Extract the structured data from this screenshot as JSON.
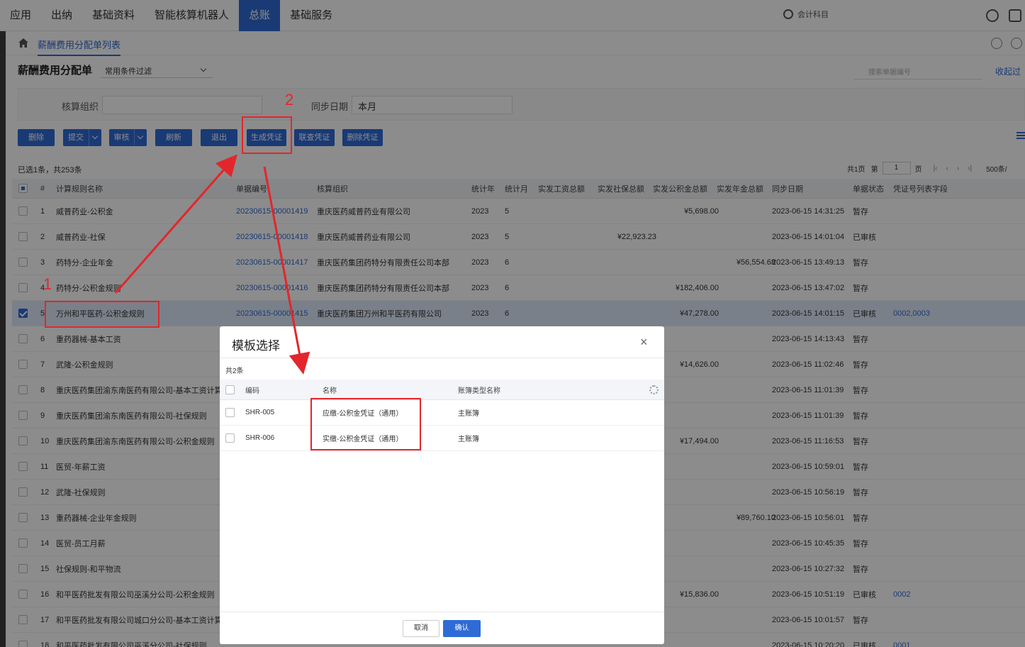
{
  "nav": {
    "items": [
      {
        "label": "应用",
        "active": false
      },
      {
        "label": "出纳",
        "active": false
      },
      {
        "label": "基础资料",
        "active": false
      },
      {
        "label": "智能核算机器人",
        "active": false
      },
      {
        "label": "总账",
        "active": true
      },
      {
        "label": "基础服务",
        "active": false
      }
    ],
    "search_placeholder": "会计科目"
  },
  "breadcrumb": {
    "current": "薪酬费用分配单列表"
  },
  "page": {
    "title": "薪酬费用分配单",
    "filter_select": "常用条件过滤",
    "bill_search_placeholder": "搜索单据编号",
    "collapse": "收起过"
  },
  "query": {
    "org_label": "核算组织",
    "org_value": "",
    "date_label": "同步日期",
    "date_value": "本月"
  },
  "toolbar": {
    "delete": "删除",
    "submit": "提交",
    "audit": "审核",
    "refresh": "刷新",
    "exit": "退出",
    "gen_voucher": "生成凭证",
    "query_voucher": "联查凭证",
    "del_voucher": "删除凭证"
  },
  "list": {
    "summary": "已选1条，共253条",
    "pager": {
      "total_pages": "共1页",
      "page_prefix": "第",
      "page": "1",
      "page_suffix": "页",
      "size": "500条/"
    },
    "columns": [
      "#",
      "计算规则名称",
      "单据编号",
      "核算组织",
      "统计年",
      "统计月",
      "实发工资总额",
      "实发社保总额",
      "实发公积金总额",
      "实发年金总额",
      "同步日期",
      "单据状态",
      "凭证号列表字段"
    ],
    "rows": [
      {
        "no": "1",
        "name": "威普药业-公积金",
        "bill": "20230615-00001419",
        "org": "重庆医药威普药业有限公司",
        "year": "2023",
        "month": "5",
        "salary": "",
        "social": "",
        "fund": "¥5,698.00",
        "annuity": "",
        "date": "2023-06-15 14:31:25",
        "status": "暂存",
        "voucher": "",
        "selected": false
      },
      {
        "no": "2",
        "name": "威普药业-社保",
        "bill": "20230615-00001418",
        "org": "重庆医药威普药业有限公司",
        "year": "2023",
        "month": "5",
        "salary": "",
        "social": "¥22,923.23",
        "fund": "",
        "annuity": "",
        "date": "2023-06-15 14:01:04",
        "status": "已审核",
        "voucher": "",
        "selected": false
      },
      {
        "no": "3",
        "name": "药特分-企业年金",
        "bill": "20230615-00001417",
        "org": "重庆医药集团药特分有限责任公司本部",
        "year": "2023",
        "month": "6",
        "salary": "",
        "social": "",
        "fund": "",
        "annuity": "¥56,554.68",
        "date": "2023-06-15 13:49:13",
        "status": "暂存",
        "voucher": "",
        "selected": false
      },
      {
        "no": "4",
        "name": "药特分-公积金规则",
        "bill": "20230615-00001416",
        "org": "重庆医药集团药特分有限责任公司本部",
        "year": "2023",
        "month": "6",
        "salary": "",
        "social": "",
        "fund": "¥182,406.00",
        "annuity": "",
        "date": "2023-06-15 13:47:02",
        "status": "暂存",
        "voucher": "",
        "selected": false
      },
      {
        "no": "5",
        "name": "万州和平医药-公积金规则",
        "bill": "20230615-00001415",
        "org": "重庆医药集团万州和平医药有限公司",
        "year": "2023",
        "month": "6",
        "salary": "",
        "social": "",
        "fund": "¥47,278.00",
        "annuity": "",
        "date": "2023-06-15 14:01:15",
        "status": "已审核",
        "voucher": "0002,0003",
        "selected": true
      },
      {
        "no": "6",
        "name": "重药器械-基本工资",
        "bill": "",
        "org": "",
        "year": "",
        "month": "",
        "salary": "",
        "social": "",
        "fund": "",
        "annuity": "",
        "date": "2023-06-15 14:13:43",
        "status": "暂存",
        "voucher": "",
        "selected": false
      },
      {
        "no": "7",
        "name": "武隆-公积金规则",
        "bill": "",
        "org": "",
        "year": "",
        "month": "",
        "salary": "",
        "social": "",
        "fund": "¥14,626.00",
        "annuity": "",
        "date": "2023-06-15 11:02:46",
        "status": "暂存",
        "voucher": "",
        "selected": false
      },
      {
        "no": "8",
        "name": "重庆医药集团渝东南医药有限公司-基本工资计算",
        "bill": "",
        "org": "",
        "year": "",
        "month": "",
        "salary": "",
        "social": "",
        "fund": "",
        "annuity": "",
        "date": "2023-06-15 11:01:39",
        "status": "暂存",
        "voucher": "",
        "selected": false
      },
      {
        "no": "9",
        "name": "重庆医药集团渝东南医药有限公司-社保规则",
        "bill": "",
        "org": "",
        "year": "",
        "month": "",
        "salary": "",
        "social": "",
        "fund": "",
        "annuity": "",
        "date": "2023-06-15 11:01:39",
        "status": "暂存",
        "voucher": "",
        "selected": false
      },
      {
        "no": "10",
        "name": "重庆医药集团渝东南医药有限公司-公积金规则",
        "bill": "",
        "org": "",
        "year": "",
        "month": "",
        "salary": "",
        "social": "",
        "fund": "¥17,494.00",
        "annuity": "",
        "date": "2023-06-15 11:16:53",
        "status": "暂存",
        "voucher": "",
        "selected": false
      },
      {
        "no": "11",
        "name": "医贸-年薪工资",
        "bill": "",
        "org": "",
        "year": "",
        "month": "",
        "salary": "",
        "social": "",
        "fund": "",
        "annuity": "",
        "date": "2023-06-15 10:59:01",
        "status": "暂存",
        "voucher": "",
        "selected": false
      },
      {
        "no": "12",
        "name": "武隆-社保规则",
        "bill": "",
        "org": "",
        "year": "",
        "month": "",
        "salary": "",
        "social": "",
        "fund": "",
        "annuity": "",
        "date": "2023-06-15 10:56:19",
        "status": "暂存",
        "voucher": "",
        "selected": false
      },
      {
        "no": "13",
        "name": "重药器械-企业年金规则",
        "bill": "",
        "org": "",
        "year": "",
        "month": "",
        "salary": "",
        "social": "",
        "fund": "",
        "annuity": "¥89,760.10",
        "date": "2023-06-15 10:56:01",
        "status": "暂存",
        "voucher": "",
        "selected": false
      },
      {
        "no": "14",
        "name": "医贸-员工月薪",
        "bill": "",
        "org": "",
        "year": "",
        "month": "",
        "salary": "",
        "social": "",
        "fund": "",
        "annuity": "",
        "date": "2023-06-15 10:45:35",
        "status": "暂存",
        "voucher": "",
        "selected": false
      },
      {
        "no": "15",
        "name": "社保规则-和平物流",
        "bill": "",
        "org": "",
        "year": "",
        "month": "",
        "salary": "",
        "social": "",
        "fund": "",
        "annuity": "",
        "date": "2023-06-15 10:27:32",
        "status": "暂存",
        "voucher": "",
        "selected": false
      },
      {
        "no": "16",
        "name": "和平医药批发有限公司巫溪分公司-公积金规则",
        "bill": "",
        "org": "",
        "year": "",
        "month": "",
        "salary": "",
        "social": "",
        "fund": "¥15,836.00",
        "annuity": "",
        "date": "2023-06-15 10:51:19",
        "status": "已审核",
        "voucher": "0002",
        "selected": false
      },
      {
        "no": "17",
        "name": "和平医药批发有限公司城口分公司-基本工资计算",
        "bill": "",
        "org": "",
        "year": "",
        "month": "",
        "salary": "",
        "social": "",
        "fund": "",
        "annuity": "",
        "date": "2023-06-15 10:01:57",
        "status": "暂存",
        "voucher": "",
        "selected": false
      },
      {
        "no": "18",
        "name": "和平医药批发有限公司巫溪分公司-社保规则",
        "bill": "",
        "org": "",
        "year": "",
        "month": "",
        "salary": "",
        "social": "",
        "fund": "",
        "annuity": "",
        "date": "2023-06-15 10:20:20",
        "status": "已审核",
        "voucher": "0001",
        "selected": false
      }
    ]
  },
  "modal": {
    "title": "模板选择",
    "close": "×",
    "count": "共2条",
    "columns": [
      "编码",
      "名称",
      "账簿类型名称"
    ],
    "rows": [
      {
        "code": "SHR-005",
        "name": "应缴-公积金凭证（通用）",
        "book": "主账簿"
      },
      {
        "code": "SHR-006",
        "name": "实缴-公积金凭证（通用）",
        "book": "主账簿"
      }
    ],
    "cancel": "取消",
    "ok": "确认"
  },
  "annotations": {
    "n1": "1",
    "n2": "2",
    "color": "#e3262c"
  },
  "colors": {
    "primary": "#2e6bd6",
    "annotation": "#e3262c"
  }
}
